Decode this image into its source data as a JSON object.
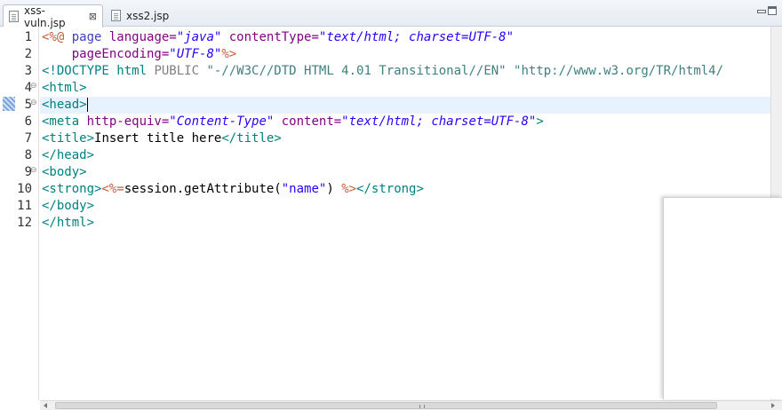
{
  "tabs": [
    {
      "label": "xss-vuln.jsp",
      "active": true
    },
    {
      "label": "xss2.jsp",
      "active": false
    }
  ],
  "line_numbers": [
    "1",
    "2",
    "3",
    "4",
    "5",
    "6",
    "7",
    "8",
    "9",
    "10",
    "11",
    "12"
  ],
  "code": {
    "l1": {
      "a": "<%@ ",
      "b": "page ",
      "c": "language=",
      "d": "\"java\"",
      "e": " contentType=",
      "f": "\"text/html; charset=UTF-8\""
    },
    "l2": {
      "a": "    pageEncoding=",
      "b": "\"UTF-8\"",
      "c": "%>"
    },
    "l3": {
      "a": "<!DOCTYPE html ",
      "b": "PUBLIC ",
      "c": "\"-//W3C//DTD HTML 4.01 Transitional//EN\"",
      "d": " \"http://www.w3.org/TR/html4/"
    },
    "l4": {
      "a": "<html>"
    },
    "l5": {
      "a": "<head>"
    },
    "l6": {
      "a": "<meta ",
      "b": "http-equiv=",
      "c": "\"Content-Type\"",
      "d": " content=",
      "e": "\"text/html; charset=UTF-8\"",
      "f": ">"
    },
    "l7": {
      "a": "<title>",
      "b": "Insert title here",
      "c": "</title>"
    },
    "l8": {
      "a": "</head>"
    },
    "l9": {
      "a": "<body>"
    },
    "l10": {
      "a": "<strong>",
      "b": "<%=",
      "c": "session.getAttribute(",
      "d": "\"name\"",
      "e": ") ",
      "f": "%>",
      "g": "</strong>"
    },
    "l11": {
      "a": "</body>"
    },
    "l12": {
      "a": "</html>"
    }
  },
  "fold_marker": "⊖",
  "tab_close_glyph": "⊠"
}
